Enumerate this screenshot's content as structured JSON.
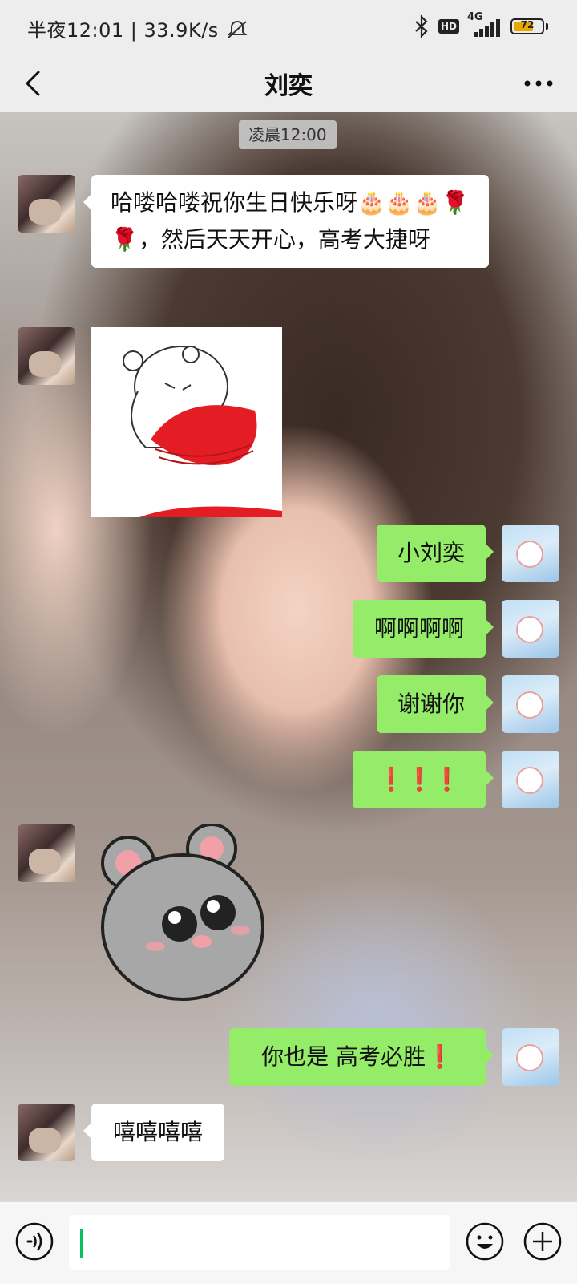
{
  "status_bar": {
    "left_text": "半夜12:01 | 33.9K/s",
    "network": "4G",
    "hd": "HD",
    "battery": 72,
    "battery_label": "72"
  },
  "header": {
    "title": "刘奕"
  },
  "chat": {
    "timestamp": "凌晨12:00",
    "messages": [
      {
        "side": "left",
        "type": "text",
        "text": "哈喽哈喽祝你生日快乐呀🎂🎂🎂🌹🌹，然后天天开心，高考大捷呀"
      },
      {
        "side": "left",
        "type": "sticker",
        "sticker": "white-bear-holding-red-hearts"
      },
      {
        "side": "right",
        "type": "text",
        "text": "小刘奕"
      },
      {
        "side": "right",
        "type": "text",
        "text": "啊啊啊啊"
      },
      {
        "side": "right",
        "type": "text",
        "text": "谢谢你"
      },
      {
        "side": "right",
        "type": "text",
        "text": "❗❗❗"
      },
      {
        "side": "left",
        "type": "sticker",
        "sticker": "grey-mouse-crying-eyes"
      },
      {
        "side": "right",
        "type": "text",
        "text": "你也是  高考必胜❗"
      },
      {
        "side": "left",
        "type": "text",
        "text": "嘻嘻嘻嘻"
      }
    ]
  },
  "colors": {
    "incoming_bubble": "#ffffff",
    "outgoing_bubble": "#95ec69",
    "caret": "#07c160",
    "bar_bg": "#ededed"
  },
  "icons": [
    "bluetooth-icon",
    "signal-icon",
    "battery-icon",
    "mute-icon",
    "back-icon",
    "more-icon",
    "voice-icon",
    "emoji-icon",
    "plus-icon"
  ]
}
